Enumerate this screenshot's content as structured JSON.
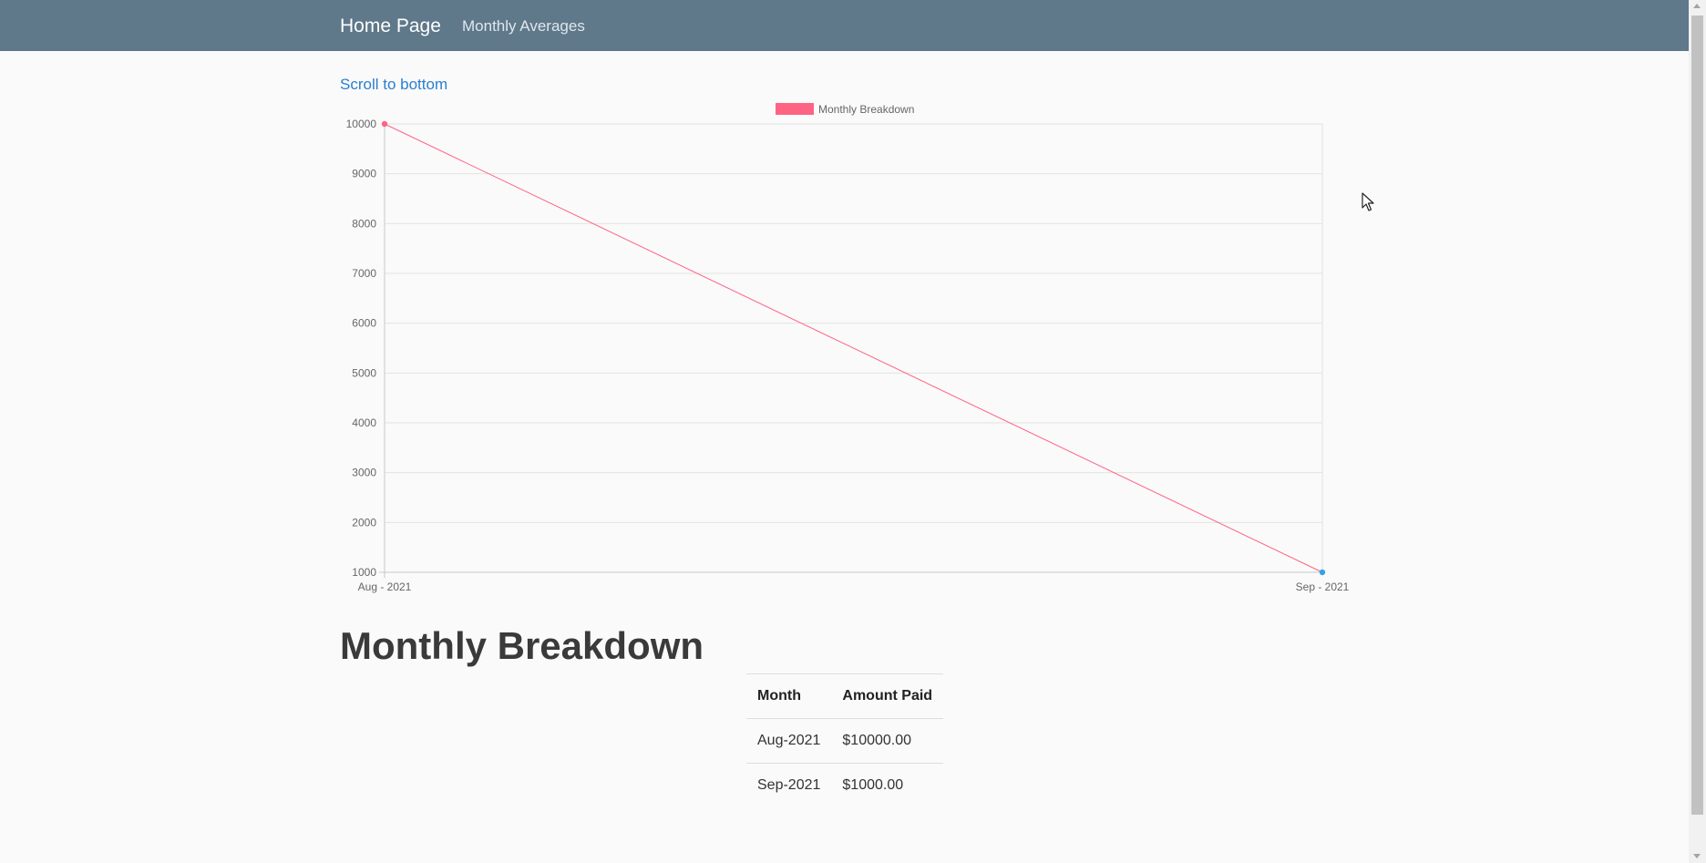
{
  "navbar": {
    "brand": "Home Page",
    "links": [
      "Monthly Averages"
    ]
  },
  "scroll_link": "Scroll to bottom",
  "chart_data": {
    "type": "line",
    "categories": [
      "Aug - 2021",
      "Sep - 2021"
    ],
    "series": [
      {
        "name": "Monthly Breakdown",
        "values": [
          10000,
          1000
        ],
        "color": "#ff6384",
        "point_colors": [
          "#ff6384",
          "#36a2eb"
        ]
      }
    ],
    "y_ticks": [
      10000,
      9000,
      8000,
      7000,
      6000,
      5000,
      4000,
      3000,
      2000,
      1000
    ],
    "ylim": [
      1000,
      10000
    ],
    "grid": true,
    "legend_position": "top"
  },
  "section": {
    "title": "Monthly Breakdown",
    "table": {
      "headers": [
        "Month",
        "Amount Paid"
      ],
      "rows": [
        [
          "Aug-2021",
          "$10000.00"
        ],
        [
          "Sep-2021",
          "$1000.00"
        ]
      ]
    }
  },
  "colors": {
    "navbar": "#5f788a",
    "link": "#2a7fcf",
    "background": "#fafafa"
  }
}
